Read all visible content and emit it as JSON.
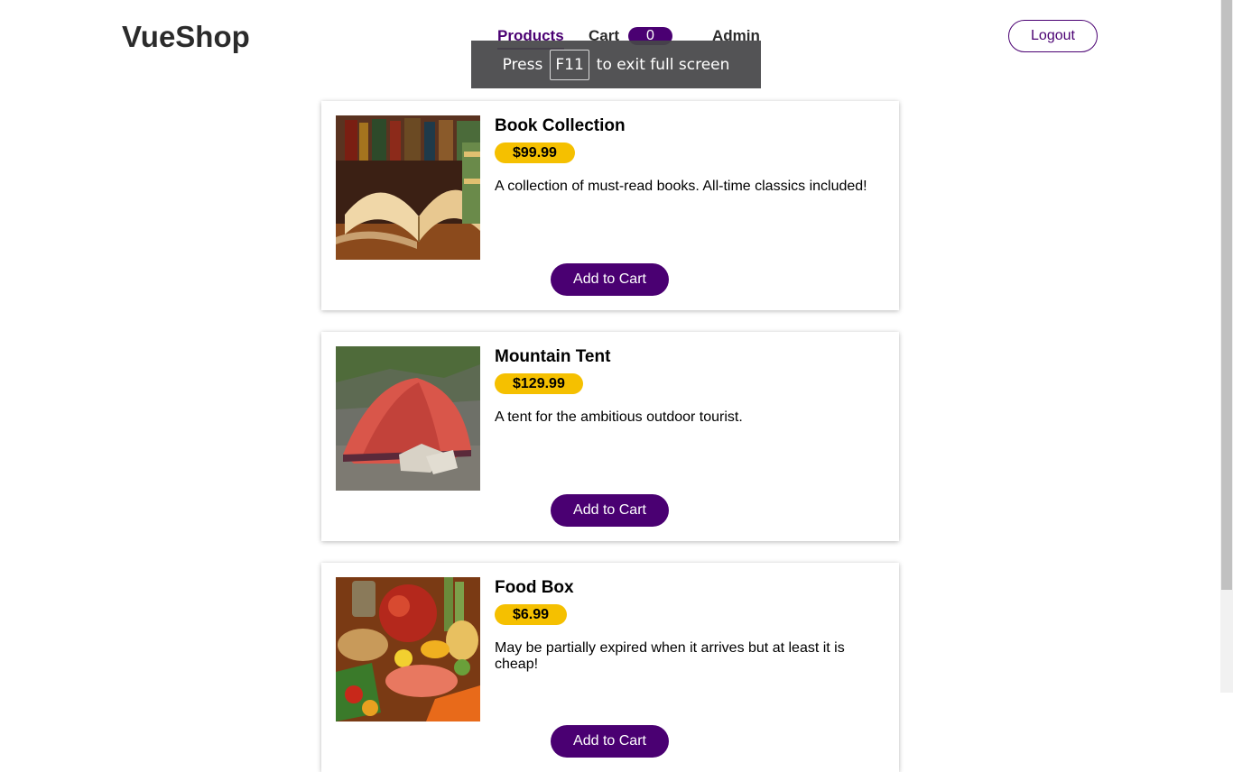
{
  "header": {
    "logo": "VueShop",
    "nav": {
      "products": "Products",
      "cart": "Cart",
      "cart_count": "0",
      "admin": "Admin"
    },
    "logout": "Logout"
  },
  "fullscreen_notice": {
    "before": "Press",
    "key": "F11",
    "after": "to exit full screen"
  },
  "products": [
    {
      "title": "Book Collection",
      "price": "$99.99",
      "description": "A collection of must-read books. All-time classics included!",
      "button": "Add to Cart"
    },
    {
      "title": "Mountain Tent",
      "price": "$129.99",
      "description": "A tent for the ambitious outdoor tourist.",
      "button": "Add to Cart"
    },
    {
      "title": "Food Box",
      "price": "$6.99",
      "description": "May be partially expired when it arrives but at least it is cheap!",
      "button": "Add to Cart"
    }
  ],
  "colors": {
    "accent": "#4a0072",
    "price_badge": "#f5c000"
  }
}
